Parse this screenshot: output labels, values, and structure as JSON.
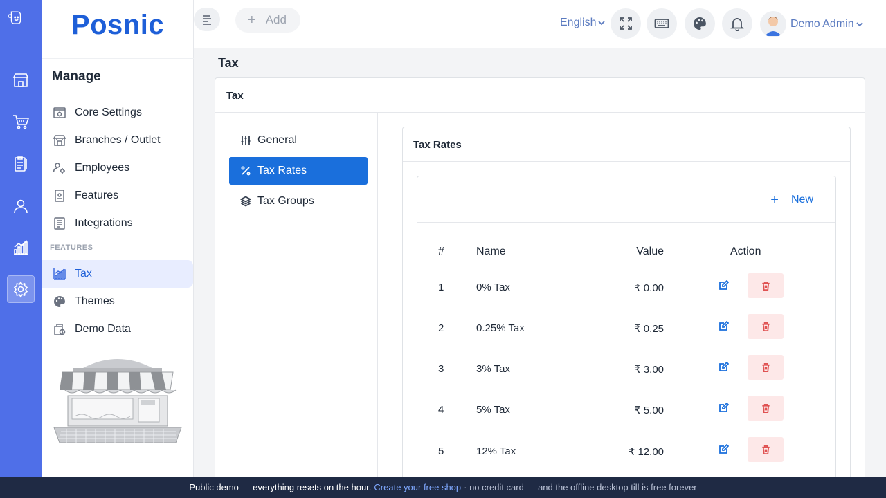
{
  "brand": {
    "name": "Posnic"
  },
  "rail": {
    "items": [
      "logo-icon",
      "store-icon",
      "cart-icon",
      "clipboard-icon",
      "user-icon",
      "chart-icon",
      "gear-icon"
    ],
    "active": "gear-icon"
  },
  "panel": {
    "title": "Manage",
    "items": [
      {
        "label": "Core Settings",
        "icon": "core-settings-icon"
      },
      {
        "label": "Branches / Outlet",
        "icon": "branch-icon"
      },
      {
        "label": "Employees",
        "icon": "employees-icon"
      },
      {
        "label": "Features",
        "icon": "features-icon"
      },
      {
        "label": "Integrations",
        "icon": "integrations-icon"
      }
    ],
    "section_label": "FEATURES",
    "feature_items": [
      {
        "label": "Tax",
        "icon": "tax-chart-icon",
        "active": true
      },
      {
        "label": "Themes",
        "icon": "palette-icon"
      },
      {
        "label": "Demo Data",
        "icon": "demo-data-icon"
      }
    ]
  },
  "topbar": {
    "add_label": "Add",
    "language": "English",
    "user_name": "Demo Admin"
  },
  "page": {
    "title": "Tax"
  },
  "card": {
    "title": "Tax",
    "tabs": [
      {
        "label": "General",
        "icon": "sliders-icon"
      },
      {
        "label": "Tax Rates",
        "icon": "percent-icon",
        "active": true
      },
      {
        "label": "Tax Groups",
        "icon": "layers-icon"
      }
    ]
  },
  "tax_rates": {
    "title": "Tax Rates",
    "new_label": "New",
    "columns": {
      "num": "#",
      "name": "Name",
      "value": "Value",
      "action": "Action"
    },
    "rows": [
      {
        "num": "1",
        "name": "0% Tax",
        "value": "₹ 0.00"
      },
      {
        "num": "2",
        "name": "0.25% Tax",
        "value": "₹ 0.25"
      },
      {
        "num": "3",
        "name": "3% Tax",
        "value": "₹ 3.00"
      },
      {
        "num": "4",
        "name": "5% Tax",
        "value": "₹ 5.00"
      },
      {
        "num": "5",
        "name": "12% Tax",
        "value": "₹ 12.00"
      }
    ]
  },
  "banner": {
    "text": "Public demo — everything resets on the hour.",
    "link": "Create your free shop",
    "rest": "· no credit card — and the offline desktop till is free forever"
  },
  "colors": {
    "accent": "#1a6fdc",
    "rail": "#4f6fe8",
    "brand": "#1e5fd8",
    "danger_bg": "#fde8e8",
    "danger": "#e05252"
  }
}
